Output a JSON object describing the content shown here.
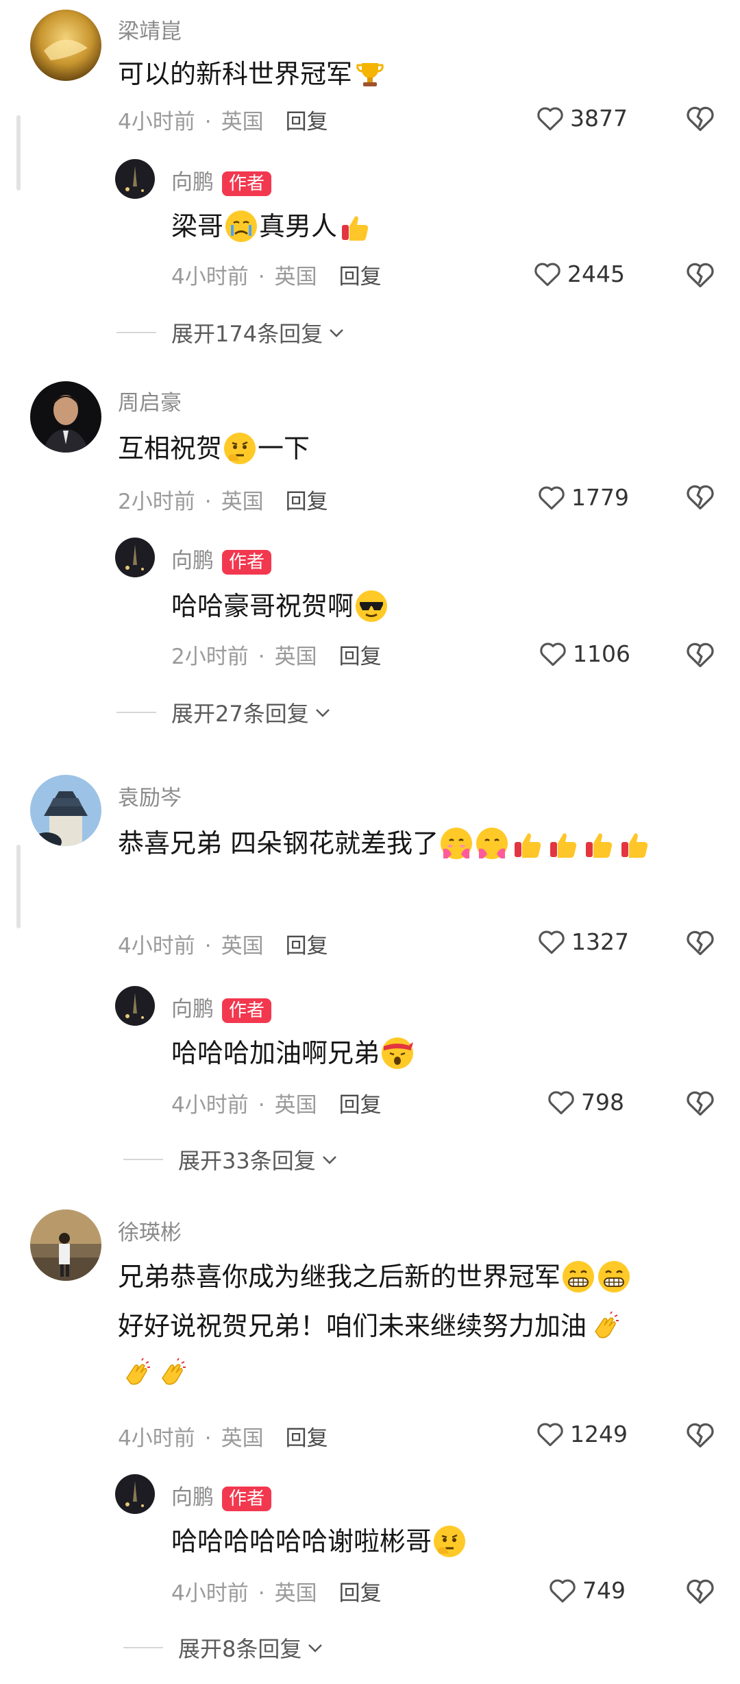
{
  "common": {
    "time_4h": "4小时前",
    "time_2h": "2小时前",
    "location": "英国",
    "reply_label": "回复",
    "separator": "·",
    "author_badge": "作者"
  },
  "threads": [
    {
      "user": "梁靖崑",
      "text": "可以的新科世界冠军",
      "likes": "3877",
      "author_reply": {
        "user": "向鹏",
        "text_a": "梁哥",
        "text_b": "真男人",
        "likes": "2445"
      },
      "expand": "展开174条回复"
    },
    {
      "user": "周启豪",
      "text_a": "互相祝贺",
      "text_b": "一下",
      "likes": "1779",
      "author_reply": {
        "user": "向鹏",
        "text": "哈哈豪哥祝贺啊",
        "likes": "1106"
      },
      "expand": "展开27条回复"
    },
    {
      "user": "袁励岑",
      "text": "恭喜兄弟 四朵钢花就差我了",
      "likes": "1327",
      "author_reply": {
        "user": "向鹏",
        "text": "哈哈哈加油啊兄弟",
        "likes": "798"
      },
      "expand": "展开33条回复"
    },
    {
      "user": "徐瑛彬",
      "text_line1": "兄弟恭喜你成为继我之后新的世界冠军",
      "text_line2": "好好说祝贺兄弟！咱们未来继续努力加油",
      "likes": "1249",
      "author_reply": {
        "user": "向鹏",
        "text": "哈哈哈哈哈哈谢啦彬哥",
        "likes": "749"
      },
      "expand": "展开8条回复"
    }
  ],
  "colors": {
    "badge": "#f2384f",
    "meta": "#9a9a9a",
    "username": "#8a8a8a"
  },
  "icons": [
    "heart-icon",
    "broken-heart-icon",
    "chevron-down-icon",
    "trophy-emoji",
    "crying-emoji",
    "thumbs-up-emoji",
    "thinking-emoji",
    "sunglasses-emoji",
    "hug-emoji",
    "headband-emoji",
    "grin-emoji",
    "clap-emoji"
  ]
}
